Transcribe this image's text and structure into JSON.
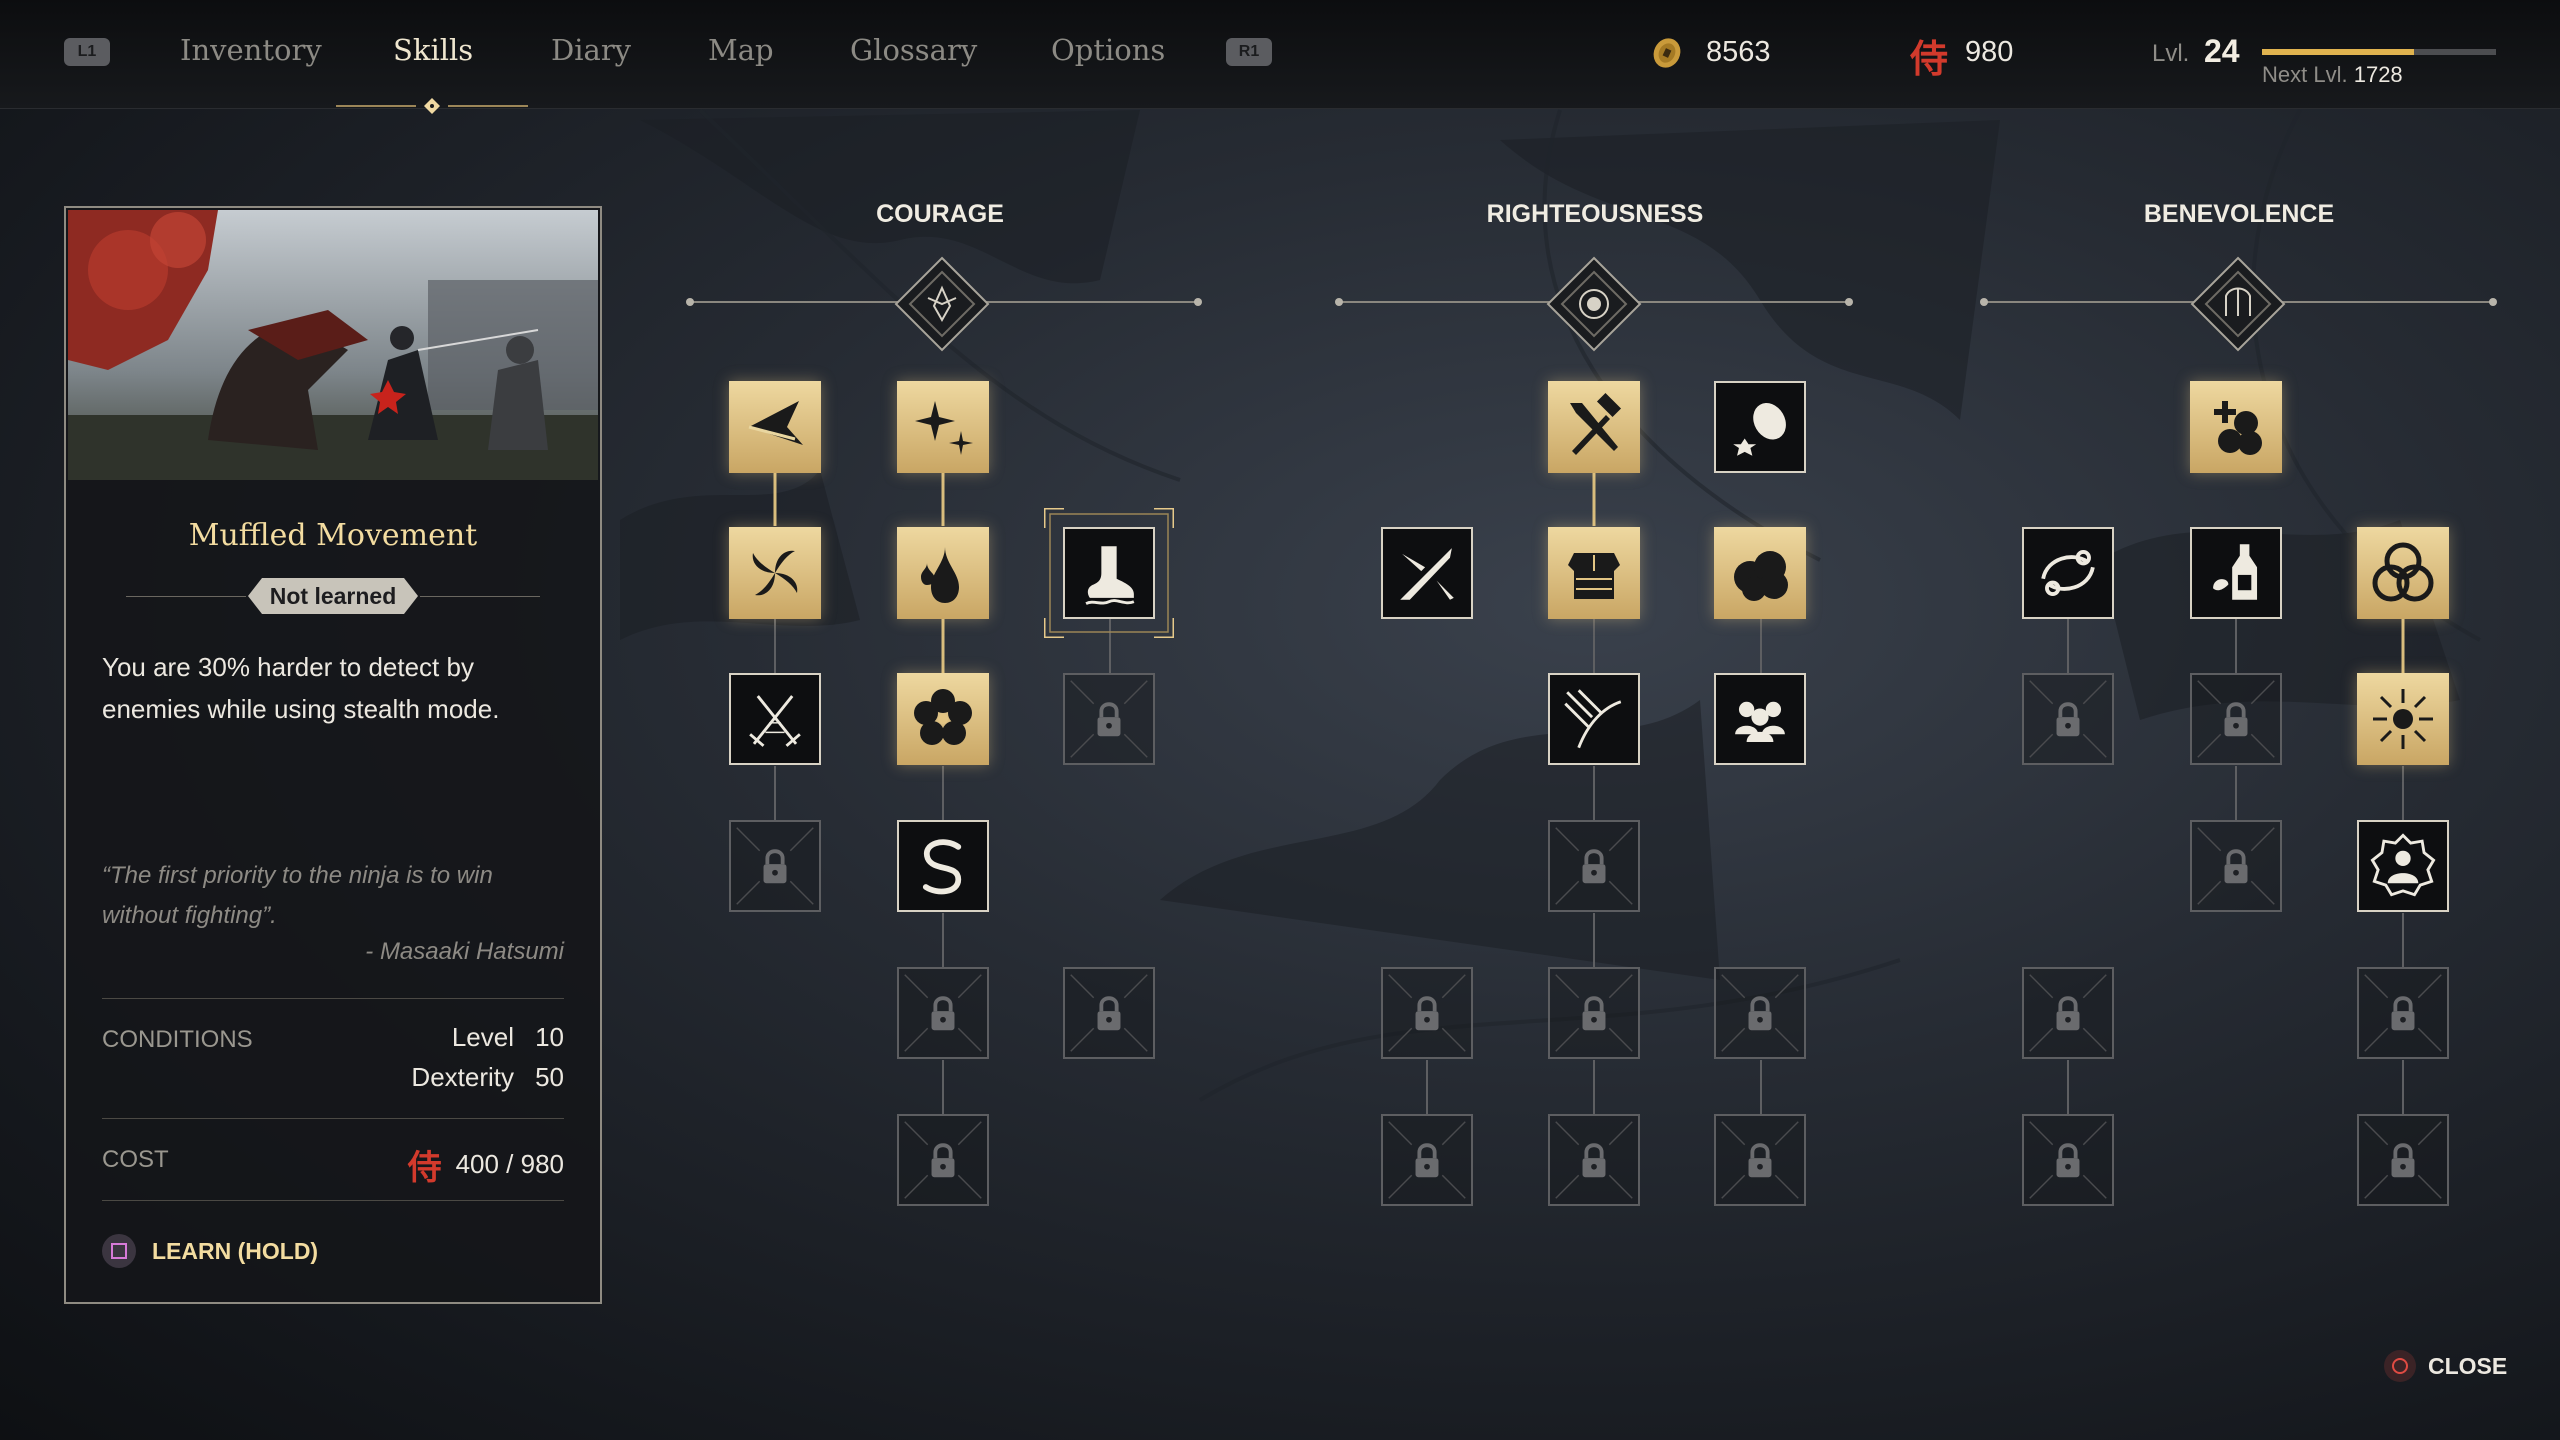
{
  "topbar": {
    "left_hint": "L1",
    "right_hint": "R1",
    "tabs": [
      {
        "label": "Inventory",
        "active": false
      },
      {
        "label": "Skills",
        "active": true
      },
      {
        "label": "Diary",
        "active": false
      },
      {
        "label": "Map",
        "active": false
      },
      {
        "label": "Glossary",
        "active": false
      },
      {
        "label": "Options",
        "active": false
      }
    ],
    "coins": "8563",
    "skill_points": "980",
    "skill_point_glyph": "侍",
    "level_label": "Lvl.",
    "level": "24",
    "next_level_label": "Next Lvl.",
    "next_level_xp": "1728",
    "xp_progress": 0.65
  },
  "detail": {
    "title": "Muffled Movement",
    "status": "Not learned",
    "description": "You are 30% harder to detect by enemies while using stealth mode.",
    "quote": "“The first priority to the ninja is to win without fighting”.",
    "quote_author": "- Masaaki Hatsumi",
    "conditions_label": "CONDITIONS",
    "conditions": [
      {
        "name": "Level",
        "value": "10"
      },
      {
        "name": "Dexterity",
        "value": "50"
      }
    ],
    "cost_label": "COST",
    "cost_glyph": "侍",
    "cost_value": "400 / 980",
    "learn_label": "LEARN (HOLD)"
  },
  "trees": [
    {
      "title": "COURAGE",
      "emblem": "crest-icon"
    },
    {
      "title": "RIGHTEOUSNESS",
      "emblem": "mon-icon"
    },
    {
      "title": "BENEVOLENCE",
      "emblem": "helmet-icon"
    }
  ],
  "colors": {
    "gold": "#e3c584",
    "accent_red": "#d23a2c",
    "title_gold": "#f3dca0"
  },
  "close_label": "CLOSE"
}
